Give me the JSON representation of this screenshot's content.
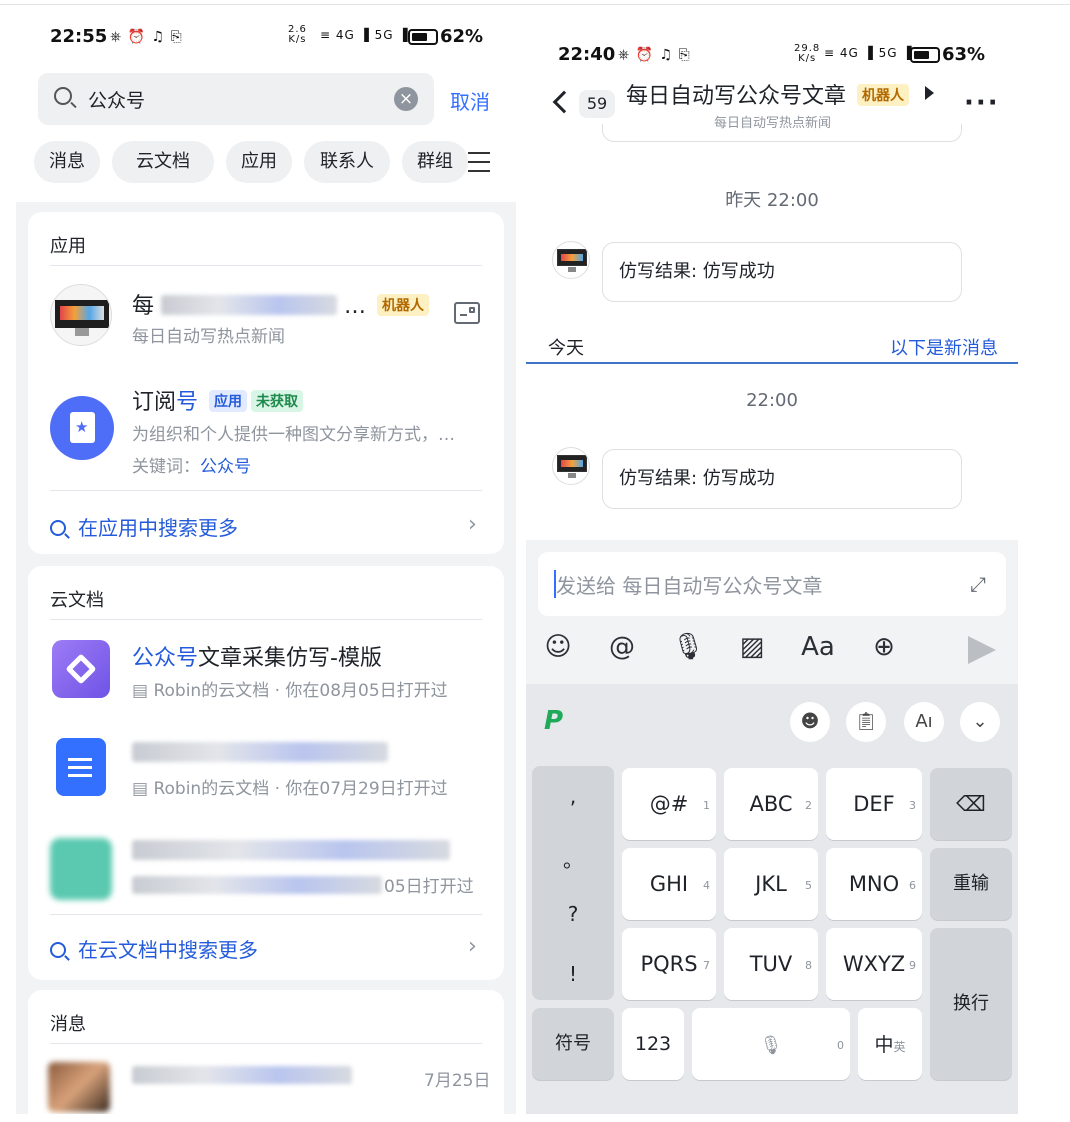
{
  "left": {
    "status": {
      "time": "22:55",
      "icons": "⎈ ⏰ ♫ ⎘",
      "speed_top": "2.6",
      "speed_bottom": "K/s",
      "signal": "≡ 4G ▐ 5G ▐",
      "battery": "62%"
    },
    "search": {
      "value": "公众号",
      "clear_icon": "clear-icon",
      "cancel_label": "取消"
    },
    "filters": [
      "消息",
      "云文档",
      "应用",
      "联系人",
      "群组"
    ],
    "apps_section": {
      "header": "应用",
      "items": [
        {
          "title_visible": "每",
          "title_tail": "…",
          "tag": "机器人",
          "subtitle": "每日自动写热点新闻"
        },
        {
          "title_plain": "订阅",
          "title_highlight": "号",
          "tag_app": "应用",
          "tag_status": "未获取",
          "desc": "为组织和个人提供一种图文分享新方式，…",
          "keyword_label": "关键词：",
          "keyword_value": "公众号"
        }
      ],
      "more_label": "在应用中搜索更多"
    },
    "docs_section": {
      "header": "云文档",
      "items": [
        {
          "title_highlight": "公众号",
          "title_rest": "文章采集仿写-模版",
          "meta": "Robin的云文档 · 你在08月05日打开过"
        },
        {
          "meta": "Robin的云文档 · 你在07月29日打开过"
        },
        {
          "meta": "05日打开过"
        }
      ],
      "more_label": "在云文档中搜索更多"
    },
    "messages_section": {
      "header": "消息",
      "items": [
        {
          "date": "7月25日"
        }
      ]
    }
  },
  "right": {
    "status": {
      "time": "22:40",
      "icons": "⎈ ⏰ ♫ ⎘",
      "speed_top": "29.8",
      "speed_bottom": "K/s",
      "signal": "≡ 4G ▐ 5G ▐",
      "battery": "63%"
    },
    "header": {
      "unread": "59",
      "title": "每日自动写公众号文章",
      "tag": "机器人",
      "subtitle": "每日自动写热点新闻"
    },
    "chat": {
      "ts1": "昨天 22:00",
      "msg1": "仿写结果: 仿写成功",
      "today": "今天",
      "new_divider": "以下是新消息",
      "ts2": "22:00",
      "msg2": "仿写结果: 仿写成功"
    },
    "input": {
      "placeholder": "发送给 每日自动写公众号文章"
    },
    "toolbar": [
      "emoji-icon",
      "mention-icon",
      "mic-icon",
      "image-icon",
      "font-icon",
      "plus-icon",
      "send-icon"
    ],
    "keyboard": {
      "side": [
        ",",
        "。",
        "?",
        "!"
      ],
      "rows": [
        [
          {
            "label": "@#",
            "num": "1"
          },
          {
            "label": "ABC",
            "num": "2"
          },
          {
            "label": "DEF",
            "num": "3"
          }
        ],
        [
          {
            "label": "GHI",
            "num": "4"
          },
          {
            "label": "JKL",
            "num": "5"
          },
          {
            "label": "MNO",
            "num": "6"
          }
        ],
        [
          {
            "label": "PQRS",
            "num": "7"
          },
          {
            "label": "TUV",
            "num": "8"
          },
          {
            "label": "WXYZ",
            "num": "9"
          }
        ]
      ],
      "delete": "⌫",
      "reenter": "重输",
      "newline": "换行",
      "symbols": "符号",
      "numbers": "123",
      "space_num": "0",
      "lang_main": "中",
      "lang_sub": "英"
    }
  }
}
